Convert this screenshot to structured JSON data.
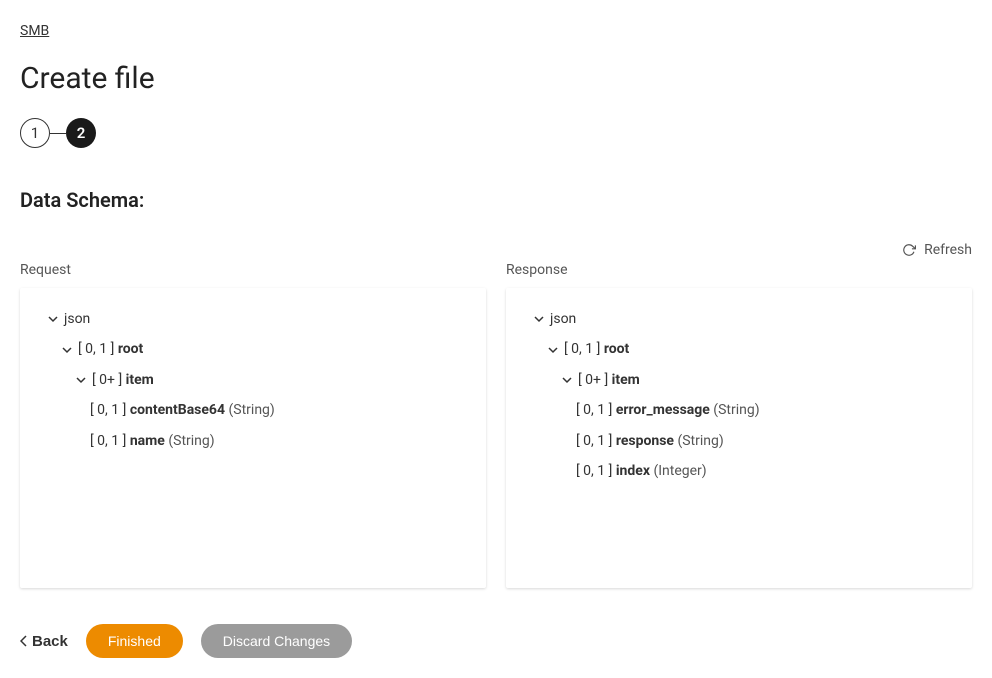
{
  "breadcrumb": "SMB",
  "page_title": "Create file",
  "steps": {
    "step1": "1",
    "step2": "2"
  },
  "section_title": "Data Schema:",
  "refresh_label": "Refresh",
  "request": {
    "label": "Request",
    "root_label": "json",
    "tree": {
      "root": {
        "card": "[ 0, 1 ]",
        "name": "root"
      },
      "item": {
        "card": "[ 0+ ]",
        "name": "item"
      },
      "fields": [
        {
          "card": "[ 0, 1 ]",
          "name": "contentBase64",
          "type": "(String)"
        },
        {
          "card": "[ 0, 1 ]",
          "name": "name",
          "type": "(String)"
        }
      ]
    }
  },
  "response": {
    "label": "Response",
    "root_label": "json",
    "tree": {
      "root": {
        "card": "[ 0, 1 ]",
        "name": "root"
      },
      "item": {
        "card": "[ 0+ ]",
        "name": "item"
      },
      "fields": [
        {
          "card": "[ 0, 1 ]",
          "name": "error_message",
          "type": "(String)"
        },
        {
          "card": "[ 0, 1 ]",
          "name": "response",
          "type": "(String)"
        },
        {
          "card": "[ 0, 1 ]",
          "name": "index",
          "type": "(Integer)"
        }
      ]
    }
  },
  "buttons": {
    "back": "Back",
    "finished": "Finished",
    "discard": "Discard Changes"
  }
}
